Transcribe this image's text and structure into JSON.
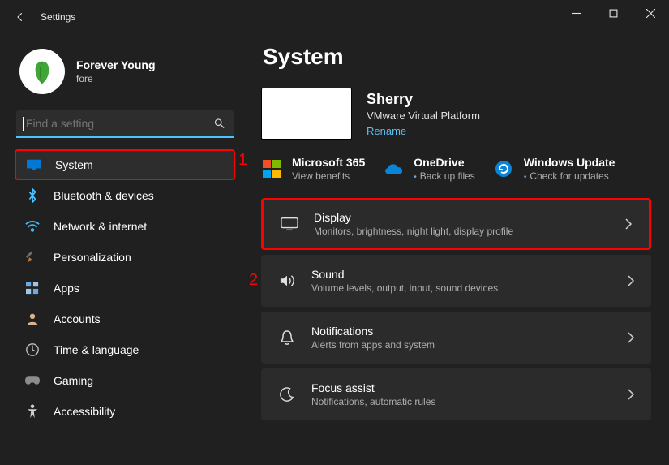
{
  "window": {
    "title": "Settings"
  },
  "profile": {
    "name": "Forever Young",
    "subtitle": "fore"
  },
  "search": {
    "placeholder": "Find a setting"
  },
  "sidebar": {
    "items": [
      {
        "label": "System",
        "icon": "monitor",
        "active": true
      },
      {
        "label": "Bluetooth & devices",
        "icon": "bluetooth",
        "active": false
      },
      {
        "label": "Network & internet",
        "icon": "wifi",
        "active": false
      },
      {
        "label": "Personalization",
        "icon": "brush",
        "active": false
      },
      {
        "label": "Apps",
        "icon": "apps",
        "active": false
      },
      {
        "label": "Accounts",
        "icon": "person",
        "active": false
      },
      {
        "label": "Time & language",
        "icon": "clock-globe",
        "active": false
      },
      {
        "label": "Gaming",
        "icon": "gamepad",
        "active": false
      },
      {
        "label": "Accessibility",
        "icon": "accessibility",
        "active": false
      }
    ]
  },
  "page": {
    "title": "System"
  },
  "device": {
    "name": "Sherry",
    "platform": "VMware Virtual Platform",
    "rename_link": "Rename"
  },
  "promos": [
    {
      "title": "Microsoft 365",
      "subtitle": "View benefits",
      "icon": "m365"
    },
    {
      "title": "OneDrive",
      "subtitle": "Back up files",
      "icon": "onedrive"
    },
    {
      "title": "Windows Update",
      "subtitle": "Check for updates",
      "icon": "update"
    }
  ],
  "settings_list": [
    {
      "title": "Display",
      "subtitle": "Monitors, brightness, night light, display profile",
      "icon": "display"
    },
    {
      "title": "Sound",
      "subtitle": "Volume levels, output, input, sound devices",
      "icon": "sound"
    },
    {
      "title": "Notifications",
      "subtitle": "Alerts from apps and system",
      "icon": "bell"
    },
    {
      "title": "Focus assist",
      "subtitle": "Notifications, automatic rules",
      "icon": "moon"
    }
  ],
  "annotations": {
    "one": "1",
    "two": "2"
  }
}
